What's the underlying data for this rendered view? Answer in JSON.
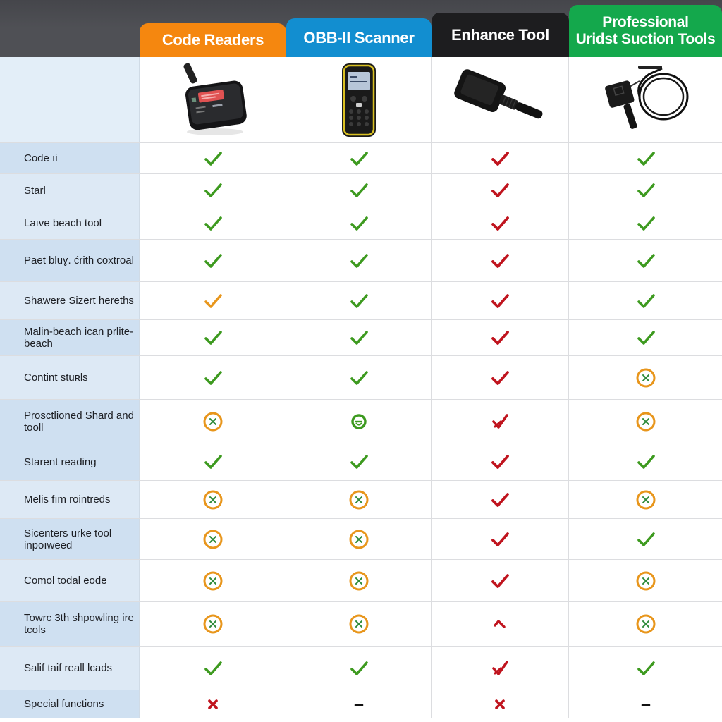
{
  "colors": {
    "header_bar": "#4f5055",
    "code_readers": "#f5870f",
    "obd_scanner": "#128ed0",
    "enhance_tool": "#1d1d1f",
    "professional": "#14a84c",
    "check_green": "#3d9a1f",
    "check_red": "#c0141e",
    "check_orange": "#e8961c",
    "partial_ring": "#e8961c",
    "label_bg": "#dde9f5"
  },
  "columns": [
    {
      "title": "Code Readers",
      "image": "code-reader-device"
    },
    {
      "title": "OBB-II Scanner",
      "image": "handheld-obd-scanner-device"
    },
    {
      "title": "Enhance Tool",
      "image": "enhance-tool-connector-device"
    },
    {
      "title": "Professional Uridst Suction Tools",
      "image": "professional-cable-tool-device"
    }
  ],
  "legend_icons": {
    "check-green": "green checkmark",
    "check-red": "red checkmark",
    "check-orange": "orange checkmark",
    "partial": "orange ring with green x",
    "circle-green": "green ring icon",
    "x-red": "red x mark",
    "dash": "dash",
    "caret-red": "red caret"
  },
  "rows": [
    {
      "label": "Code ıi",
      "values": [
        "check-green",
        "check-green",
        "check-red",
        "check-green"
      ]
    },
    {
      "label": "Starl",
      "values": [
        "check-green",
        "check-green",
        "check-red",
        "check-green"
      ]
    },
    {
      "label": "Laıve beach tool",
      "values": [
        "check-green",
        "check-green",
        "check-red",
        "check-green"
      ]
    },
    {
      "label": "Paet bluɣ. ćrith coxtroal",
      "values": [
        "check-green",
        "check-green",
        "check-red",
        "check-green"
      ]
    },
    {
      "label": "Shawere Sizert hereths",
      "values": [
        "check-orange",
        "check-green",
        "check-red",
        "check-green"
      ]
    },
    {
      "label": "Malin-beach ican prlite-beach",
      "values": [
        "check-green",
        "check-green",
        "check-red",
        "check-green"
      ]
    },
    {
      "label": "Contint stuʀls",
      "values": [
        "check-green",
        "check-green",
        "check-red",
        "partial"
      ]
    },
    {
      "label": "Prosctlioned Shard and tooll",
      "values": [
        "partial",
        "circle-green",
        "check-red-x",
        "partial"
      ]
    },
    {
      "label": "Starent reading",
      "values": [
        "check-green",
        "check-green",
        "check-red",
        "check-green"
      ]
    },
    {
      "label": "Melis fım rointreds",
      "values": [
        "partial",
        "partial",
        "check-red",
        "partial"
      ]
    },
    {
      "label": "Sicenters urke tool inpoıweed",
      "values": [
        "partial",
        "partial",
        "check-red",
        "check-green"
      ]
    },
    {
      "label": "Comol todal eode",
      "values": [
        "partial",
        "partial",
        "check-red",
        "partial"
      ]
    },
    {
      "label": "Towrc 3th shpowling ire tcols",
      "values": [
        "partial",
        "partial",
        "caret-red",
        "partial"
      ]
    },
    {
      "label": "Salif taif reall lcads",
      "values": [
        "check-green",
        "check-green",
        "check-red-x",
        "check-green"
      ]
    },
    {
      "label": "Special functions",
      "values": [
        "x-red",
        "dash",
        "x-red",
        "dash"
      ]
    }
  ]
}
